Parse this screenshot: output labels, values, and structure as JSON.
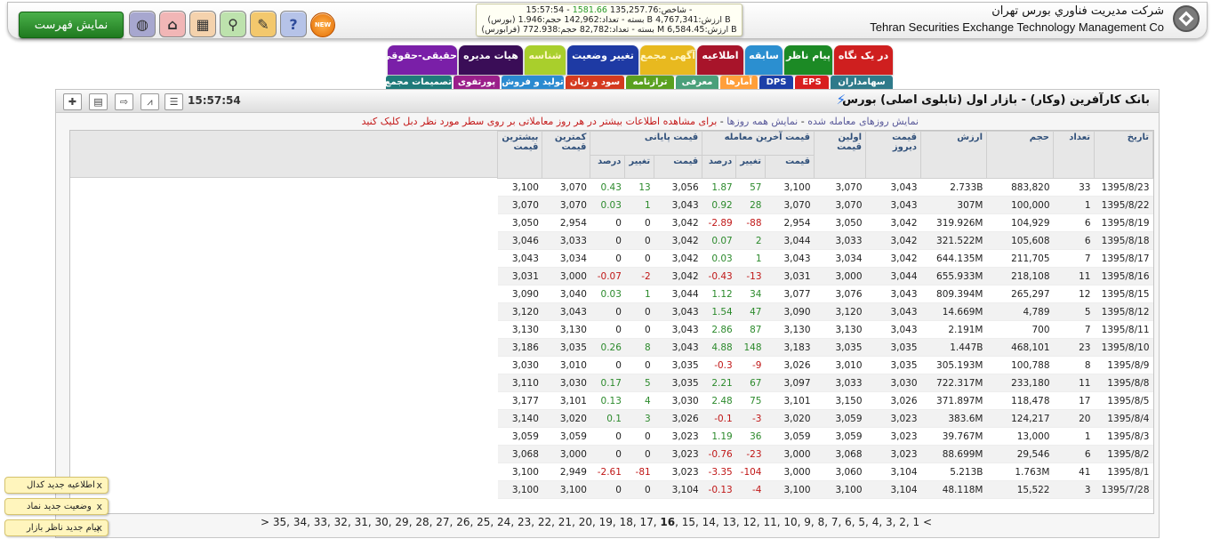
{
  "header": {
    "company_fa": "شرکت مديريت فناوري بورس تهران",
    "company_en": "Tehran Securities Exchange Technology Management Co",
    "show_list_label": "نمایش فهرست",
    "new_badge": "NEW",
    "index_line1_time": "15:57:54",
    "index_line1_change": "1581.66",
    "index_line1_rest": "شاخص:135,257.76 -",
    "index_line2": "(بورس) بسته - تعداد:142,962 حجم:1.946 B ارزش:4,767,341 B",
    "index_line3": "(فرابورس) بسته - تعداد:82,782 حجم:772.938 M ارزش:6,584.45 B"
  },
  "tabs": {
    "top": [
      {
        "label": "در یک نگاه",
        "color": "#cf1f1f"
      },
      {
        "label": "پیام ناظر",
        "color": "#1c8a25"
      },
      {
        "label": "سابقه",
        "color": "#2b8fd0"
      },
      {
        "label": "اطلاعیه",
        "color": "#a8142a"
      },
      {
        "label": "آگهی مجمع",
        "color": "#e8b91f"
      },
      {
        "label": "تغییر وضعیت",
        "color": "#1e3aa4"
      },
      {
        "label": "شناسه",
        "color": "#a9cf2c"
      },
      {
        "label": "هیات مدیره",
        "color": "#3a0d57"
      },
      {
        "label": "حقیقی-حقوقی",
        "color": "#7a1fa8"
      }
    ],
    "bottom": [
      {
        "label": "سهامداران",
        "color": "#2f7a8a"
      },
      {
        "label": "EPS",
        "color": "#d81f1f"
      },
      {
        "label": "DPS",
        "color": "#1c3fa8"
      },
      {
        "label": "آمارها",
        "color": "#ff9f3a"
      },
      {
        "label": "معرفی",
        "color": "#4aa07a"
      },
      {
        "label": "ترازنامه",
        "color": "#5aa01f"
      },
      {
        "label": "سود و زیان",
        "color": "#d43a1f"
      },
      {
        "label": "تولید و فروش",
        "color": "#2a8ad0"
      },
      {
        "label": "پورتفوی",
        "color": "#9a1f8a"
      },
      {
        "label": "تصمیمات مجمع",
        "color": "#1f7a7a"
      }
    ]
  },
  "panel": {
    "title": "بانک کارآفرین (وکار) - بازار اول (تابلوی اصلی) بورس",
    "time": "15:57:54",
    "notice_link1": "نمایش روزهای معامله شده",
    "notice_link2": "نمایش همه روزها",
    "notice_text": "برای مشاهده اطلاعات بیشتر در هر روز معاملاتی بر روی سطر مورد نظر دبل کلیک کنید"
  },
  "table": {
    "headers": {
      "date": "تاریخ",
      "count": "تعداد",
      "volume": "حجم",
      "value": "ارزش",
      "prev": "قیمت دیروز",
      "first": "اولین قیمت",
      "last_group": "قیمت آخرین معامله",
      "close_group": "قیمت پایانی",
      "price": "قیمت",
      "change": "تغییر",
      "percent": "درصد",
      "min": "کمترین قیمت",
      "max": "بیشترین قیمت"
    },
    "rows": [
      [
        "1395/8/23",
        "33",
        "883,820",
        "2.733B",
        "3,043",
        "3,070",
        "3,100",
        "57",
        "1.87",
        "3,056",
        "13",
        "0.43",
        "3,070",
        "3,100"
      ],
      [
        "1395/8/22",
        "1",
        "100,000",
        "307M",
        "3,043",
        "3,070",
        "3,070",
        "28",
        "0.92",
        "3,043",
        "1",
        "0.03",
        "3,070",
        "3,070"
      ],
      [
        "1395/8/19",
        "6",
        "104,929",
        "319.926M",
        "3,042",
        "3,050",
        "2,954",
        "-88",
        "-2.89",
        "3,042",
        "0",
        "0",
        "2,954",
        "3,050"
      ],
      [
        "1395/8/18",
        "6",
        "105,608",
        "321.522M",
        "3,042",
        "3,033",
        "3,044",
        "2",
        "0.07",
        "3,042",
        "0",
        "0",
        "3,033",
        "3,046"
      ],
      [
        "1395/8/17",
        "7",
        "211,705",
        "644.135M",
        "3,042",
        "3,034",
        "3,043",
        "1",
        "0.03",
        "3,042",
        "0",
        "0",
        "3,034",
        "3,043"
      ],
      [
        "1395/8/16",
        "11",
        "218,108",
        "655.933M",
        "3,044",
        "3,000",
        "3,031",
        "-13",
        "-0.43",
        "3,042",
        "-2",
        "-0.07",
        "3,000",
        "3,031"
      ],
      [
        "1395/8/15",
        "12",
        "265,297",
        "809.394M",
        "3,043",
        "3,076",
        "3,077",
        "34",
        "1.12",
        "3,044",
        "1",
        "0.03",
        "3,040",
        "3,090"
      ],
      [
        "1395/8/12",
        "5",
        "4,789",
        "14.669M",
        "3,043",
        "3,120",
        "3,090",
        "47",
        "1.54",
        "3,043",
        "0",
        "0",
        "3,043",
        "3,120"
      ],
      [
        "1395/8/11",
        "7",
        "700",
        "2.191M",
        "3,043",
        "3,130",
        "3,130",
        "87",
        "2.86",
        "3,043",
        "0",
        "0",
        "3,130",
        "3,130"
      ],
      [
        "1395/8/10",
        "23",
        "468,101",
        "1.447B",
        "3,035",
        "3,035",
        "3,183",
        "148",
        "4.88",
        "3,043",
        "8",
        "0.26",
        "3,035",
        "3,186"
      ],
      [
        "1395/8/9",
        "8",
        "100,788",
        "305.193M",
        "3,035",
        "3,010",
        "3,026",
        "-9",
        "-0.3",
        "3,035",
        "0",
        "0",
        "3,010",
        "3,030"
      ],
      [
        "1395/8/8",
        "11",
        "233,180",
        "722.317M",
        "3,030",
        "3,033",
        "3,097",
        "67",
        "2.21",
        "3,035",
        "5",
        "0.17",
        "3,030",
        "3,110"
      ],
      [
        "1395/8/5",
        "17",
        "118,478",
        "371.897M",
        "3,026",
        "3,150",
        "3,101",
        "75",
        "2.48",
        "3,030",
        "4",
        "0.13",
        "3,101",
        "3,177"
      ],
      [
        "1395/8/4",
        "20",
        "124,217",
        "383.6M",
        "3,023",
        "3,059",
        "3,020",
        "-3",
        "-0.1",
        "3,026",
        "3",
        "0.1",
        "3,020",
        "3,140"
      ],
      [
        "1395/8/3",
        "1",
        "13,000",
        "39.767M",
        "3,023",
        "3,059",
        "3,059",
        "36",
        "1.19",
        "3,023",
        "0",
        "0",
        "3,059",
        "3,059"
      ],
      [
        "1395/8/2",
        "6",
        "29,546",
        "88.699M",
        "3,023",
        "3,068",
        "3,000",
        "-23",
        "-0.76",
        "3,023",
        "0",
        "0",
        "3,000",
        "3,068"
      ],
      [
        "1395/8/1",
        "41",
        "1.763M",
        "5.213B",
        "3,104",
        "3,060",
        "3,000",
        "-104",
        "-3.35",
        "3,023",
        "-81",
        "-2.61",
        "2,949",
        "3,100"
      ],
      [
        "1395/7/28",
        "3",
        "15,522",
        "48.118M",
        "3,104",
        "3,100",
        "3,100",
        "-4",
        "-0.13",
        "3,104",
        "0",
        "0",
        "3,100",
        "3,100"
      ]
    ]
  },
  "pager": {
    "prev": "<",
    "next": ">",
    "pages": [
      "1",
      "2",
      "3",
      "4",
      "5",
      "6",
      "7",
      "8",
      "9",
      "10",
      "11",
      "12",
      "13",
      "14",
      "15",
      "16",
      "17",
      "18",
      "19",
      "20",
      "21",
      "22",
      "23",
      "24",
      "25",
      "26",
      "27",
      "28",
      "29",
      "30",
      "31",
      "32",
      "33",
      "34",
      "35"
    ],
    "current": "16"
  },
  "alerts": [
    {
      "text": "اطلاعیه جدید کدال"
    },
    {
      "text": "وضعیت جدید نماد"
    },
    {
      "text": "پیام جدید ناظر بازار"
    }
  ],
  "alert_close": "x"
}
